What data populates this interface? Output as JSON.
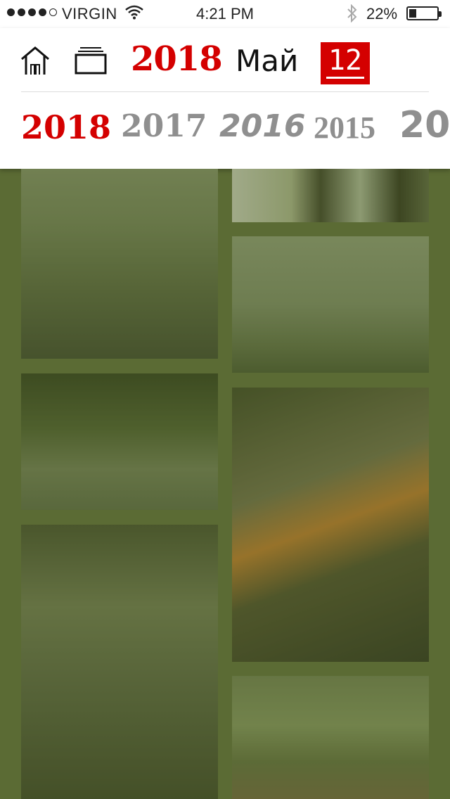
{
  "status_bar": {
    "carrier": "VIRGIN",
    "time": "4:21 PM",
    "battery": "22%",
    "battery_level": 0.22
  },
  "nav": {
    "year": "2018",
    "month": "Май",
    "day": "12"
  },
  "year_strip": [
    "2018",
    "2017",
    "2016",
    "2015",
    "20"
  ],
  "colors": {
    "accent": "#d40000",
    "background": "#5b6b34"
  },
  "photos": [
    {
      "description": "photo-street-trees"
    },
    {
      "description": "photo-people-standing"
    },
    {
      "description": "photo-arch-park"
    },
    {
      "description": "photo-soap-bubbles"
    },
    {
      "description": "photo-family-baby"
    },
    {
      "description": "photo-banquet-hall"
    },
    {
      "description": "photo-park-jumping"
    }
  ]
}
